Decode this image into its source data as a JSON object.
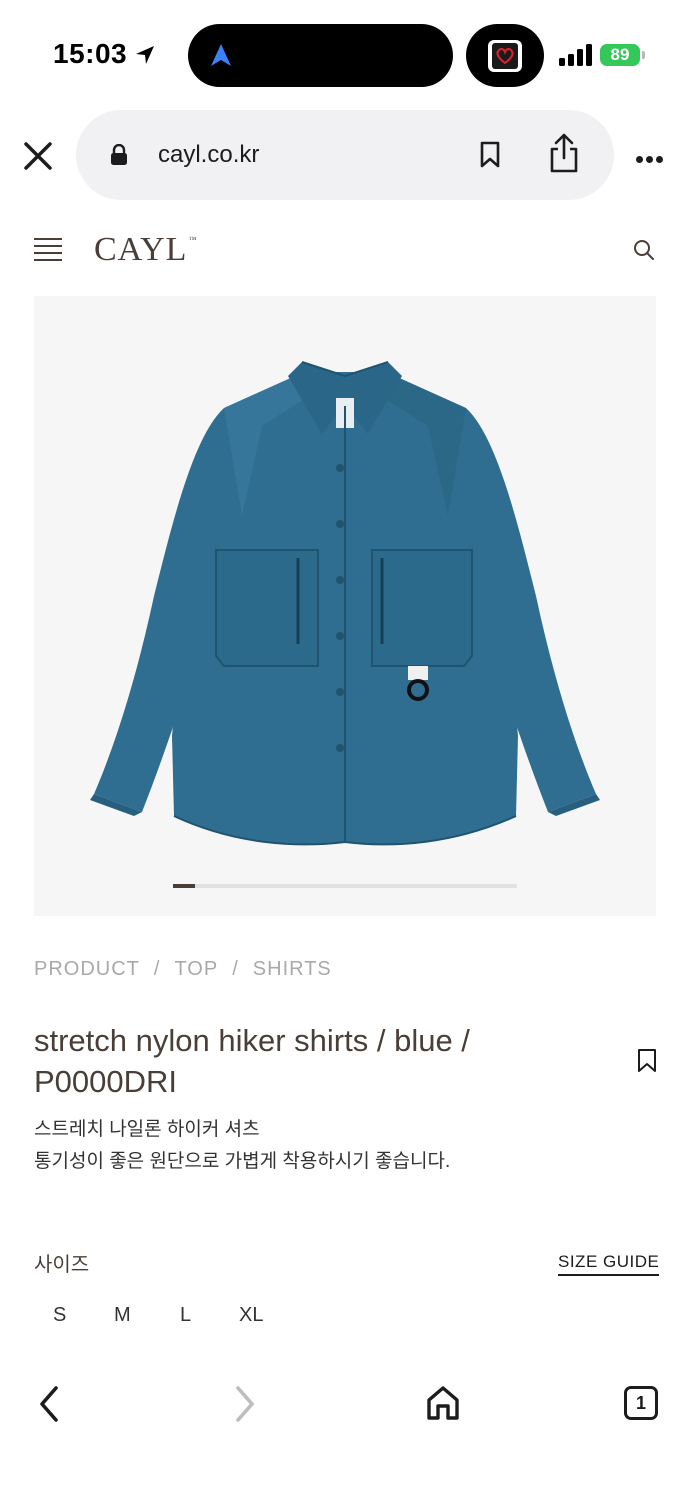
{
  "status_bar": {
    "time": "15:03",
    "battery": "89"
  },
  "browser": {
    "url": "cayl.co.kr"
  },
  "site": {
    "logo": "CAYL",
    "logo_mark": "™"
  },
  "gallery": {
    "progress": 0.065
  },
  "breadcrumb": [
    "PRODUCT",
    "TOP",
    "SHIRTS"
  ],
  "breadcrumb_sep": "/",
  "product": {
    "title": "stretch nylon hiker shirts / blue / P0000DRI",
    "subtitle": "스트레치 나일론 하이커 셔츠",
    "description": "통기성이 좋은 원단으로 가볍게 착용하시기 좋습니다.",
    "size_label": "사이즈",
    "size_guide": "SIZE GUIDE",
    "sizes": [
      "S",
      "M",
      "L",
      "XL"
    ]
  },
  "toolbar": {
    "tab_count": "1"
  },
  "colors": {
    "accent_brown": "#4a3f38",
    "battery_green": "#34c759",
    "shirt_blue": "#2f6e91"
  },
  "icons": [
    "location-arrow-icon",
    "navigation-icon",
    "heart-app-icon",
    "signal-icon",
    "close-icon",
    "lock-icon",
    "bookmark-icon",
    "share-icon",
    "more-icon",
    "menu-icon",
    "search-icon",
    "wishlist-icon",
    "back-icon",
    "forward-icon",
    "home-icon",
    "tabs-icon"
  ]
}
